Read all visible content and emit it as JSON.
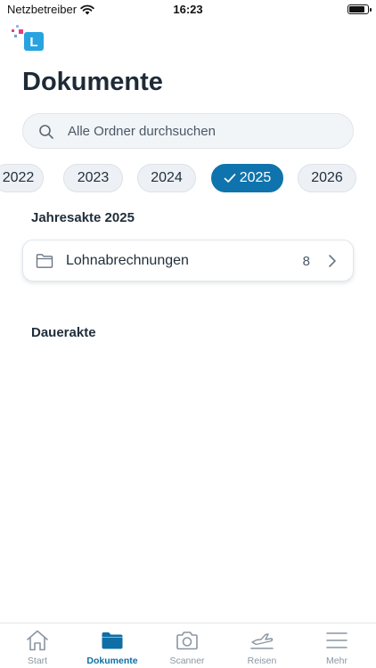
{
  "status_bar": {
    "carrier": "Netzbetreiber",
    "time": "16:23",
    "battery_level": 0.9
  },
  "app": {
    "logo_letter": "L",
    "brand_color": "#0f73ad"
  },
  "page": {
    "title": "Dokumente"
  },
  "search": {
    "placeholder": "Alle Ordner durchsuchen",
    "icon": "search-icon"
  },
  "years": {
    "items": [
      "2022",
      "2023",
      "2024",
      "2025",
      "2026"
    ],
    "selected": "2025"
  },
  "sections": {
    "annual": {
      "title": "Jahresakte 2025",
      "folders": [
        {
          "name": "Lohnabrechnungen",
          "count": "8",
          "icon": "folder-icon"
        }
      ]
    },
    "permanent": {
      "title": "Dauerakte"
    }
  },
  "tabbar": {
    "items": [
      {
        "label": "Start",
        "icon": "home-icon"
      },
      {
        "label": "Dokumente",
        "icon": "folder-icon"
      },
      {
        "label": "Scanner",
        "icon": "camera-icon"
      },
      {
        "label": "Reisen",
        "icon": "plane-icon"
      },
      {
        "label": "Mehr",
        "icon": "menu-icon"
      }
    ],
    "active": "Dokumente"
  }
}
